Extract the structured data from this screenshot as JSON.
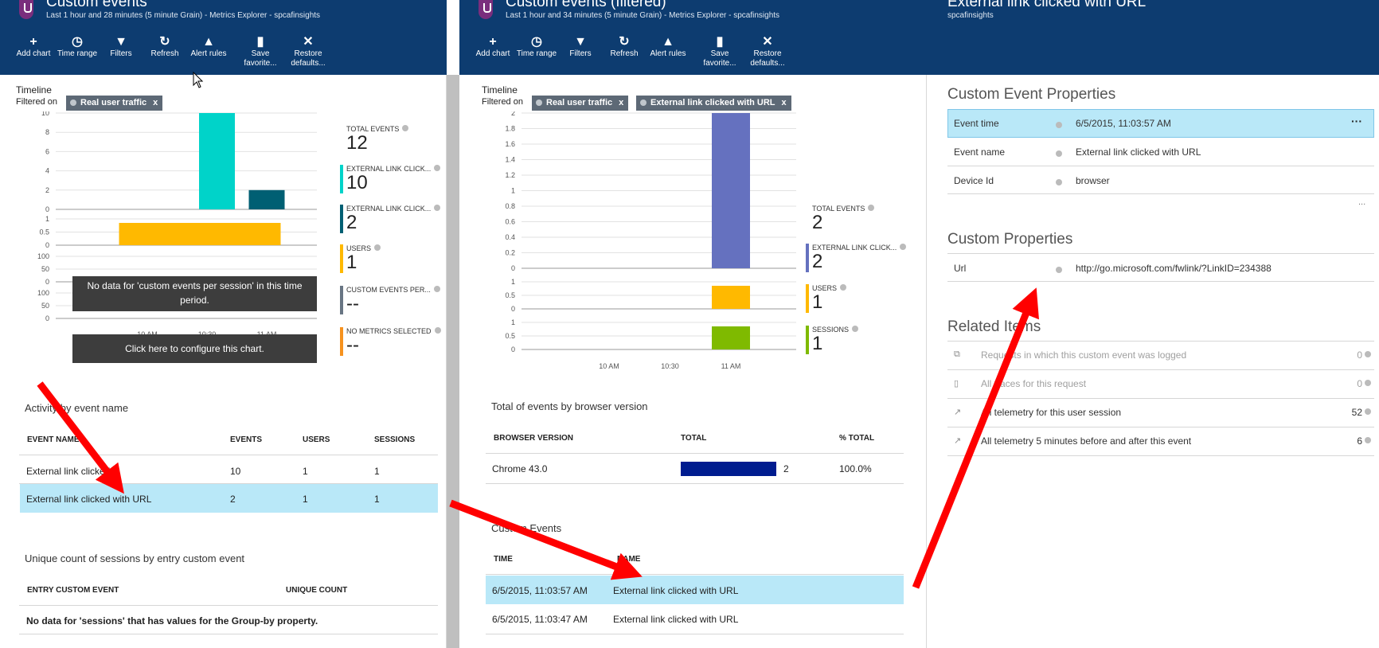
{
  "colors": {
    "header_bg": "#0d3c70",
    "highlight": "#b9e8f8",
    "teal": "#00d3c9",
    "navy_teal": "#005f73",
    "gold": "#ffb900",
    "slate": "#687583",
    "orange": "#f6921e",
    "purple": "#6571bf",
    "green": "#7fba00",
    "chrome_bar": "#001c8f",
    "arrow": "#ff0000"
  },
  "blade1": {
    "title": "Custom events",
    "subtitle": "Last 1 hour and 28 minutes (5 minute Grain) - Metrics Explorer - spcafinsights",
    "toolbar": [
      {
        "label": "Add chart",
        "icon": "plus-icon"
      },
      {
        "label": "Time range",
        "icon": "clock-icon"
      },
      {
        "label": "Filters",
        "icon": "funnel-icon"
      },
      {
        "label": "Refresh",
        "icon": "refresh-icon"
      },
      {
        "label": "Alert rules",
        "icon": "bell-icon"
      },
      {
        "label": "Save favorite...",
        "icon": "bookmark-icon"
      },
      {
        "label": "Restore defaults...",
        "icon": "close-icon"
      }
    ],
    "timeline_label": "Timeline",
    "filtered_on": "Filtered on",
    "filters": [
      "Real user traffic"
    ],
    "metrics": [
      {
        "label": "TOTAL EVENTS",
        "value": "12"
      },
      {
        "label": "EXTERNAL LINK CLICK...",
        "value": "10"
      },
      {
        "label": "EXTERNAL LINK CLICK...",
        "value": "2"
      },
      {
        "label": "USERS",
        "value": "1"
      },
      {
        "label": "CUSTOM EVENTS PER...",
        "value": "--"
      },
      {
        "label": "NO METRICS SELECTED",
        "value": "--"
      }
    ],
    "no_data_msg": "No data for 'custom events per session' in this time period.",
    "configure_msg": "Click here to configure this chart.",
    "activity_title": "Activity by event name",
    "activity_headers": [
      "EVENT NAME",
      "EVENTS",
      "USERS",
      "SESSIONS"
    ],
    "activity_rows": [
      [
        "External link clicked",
        "10",
        "1",
        "1"
      ],
      [
        "External link clicked with URL",
        "2",
        "1",
        "1"
      ]
    ],
    "unique_title": "Unique count of sessions by entry custom event",
    "unique_headers": [
      "ENTRY CUSTOM EVENT",
      "UNIQUE COUNT"
    ],
    "unique_empty": "No data for 'sessions' that has values for the Group-by property."
  },
  "blade2": {
    "title": "Custom events (filtered)",
    "subtitle": "Last 1 hour and 34 minutes (5 minute Grain) - Metrics Explorer - spcafinsights",
    "toolbar": [
      {
        "label": "Add chart",
        "icon": "plus-icon"
      },
      {
        "label": "Time range",
        "icon": "clock-icon"
      },
      {
        "label": "Filters",
        "icon": "funnel-icon"
      },
      {
        "label": "Refresh",
        "icon": "refresh-icon"
      },
      {
        "label": "Alert rules",
        "icon": "bell-icon"
      },
      {
        "label": "Save favorite...",
        "icon": "bookmark-icon"
      },
      {
        "label": "Restore defaults...",
        "icon": "close-icon"
      }
    ],
    "timeline_label": "Timeline",
    "filtered_on": "Filtered on",
    "filters": [
      "Real user traffic",
      "External link clicked with URL"
    ],
    "metrics": [
      {
        "label": "TOTAL EVENTS",
        "value": "2"
      },
      {
        "label": "EXTERNAL LINK CLICK...",
        "value": "2"
      },
      {
        "label": "USERS",
        "value": "1"
      },
      {
        "label": "SESSIONS",
        "value": "1"
      }
    ],
    "browser_title": "Total of events by browser version",
    "browser_headers": [
      "BROWSER VERSION",
      "TOTAL",
      "% TOTAL"
    ],
    "browser_rows": [
      {
        "version": "Chrome 43.0",
        "total": "2",
        "pct": "100.0%",
        "fraction": 1.0
      }
    ],
    "events_title": "Custom Events",
    "events_headers": [
      "TIME",
      "NAME"
    ],
    "events_rows": [
      [
        "6/5/2015, 11:03:57 AM",
        "External link clicked with URL"
      ],
      [
        "6/5/2015, 11:03:47 AM",
        "External link clicked with URL"
      ]
    ]
  },
  "blade3": {
    "title": "External link clicked with URL",
    "subtitle": "spcafinsights",
    "event_props_title": "Custom Event Properties",
    "event_props": [
      {
        "key": "Event time",
        "value": "6/5/2015, 11:03:57 AM"
      },
      {
        "key": "Event name",
        "value": "External link clicked with URL"
      },
      {
        "key": "Device Id",
        "value": "browser"
      }
    ],
    "more": "...",
    "custom_props_title": "Custom Properties",
    "custom_props": [
      {
        "key": "Url",
        "value": "http://go.microsoft.com/fwlink/?LinkID=234388"
      }
    ],
    "related_title": "Related Items",
    "related": [
      {
        "label": "Requests in which this custom event was logged",
        "count": "0",
        "icon": "request-icon"
      },
      {
        "label": "All traces for this request",
        "count": "0",
        "icon": "trace-icon"
      },
      {
        "label": "All telemetry for this user session",
        "count": "52",
        "icon": "arrow-link-icon"
      },
      {
        "label": "All telemetry 5 minutes before and after this event",
        "count": "6",
        "icon": "arrow-link-icon"
      }
    ]
  },
  "chart_data": [
    {
      "type": "bar",
      "title": "",
      "series": [
        {
          "name": "External link clicked",
          "x": [
            "10:35"
          ],
          "values": [
            10
          ]
        },
        {
          "name": "External link clicked with URL",
          "x": [
            "11:00"
          ],
          "values": [
            2
          ]
        }
      ],
      "x_ticks": [
        "10 AM",
        "10:30",
        "11 AM"
      ],
      "ylim": [
        0,
        10
      ],
      "y_ticks": [
        0,
        2,
        4,
        6,
        8,
        10
      ]
    },
    {
      "type": "bar",
      "title": "",
      "series": [
        {
          "name": "USERS",
          "x_range": [
            "9:45",
            "11:15"
          ],
          "values": [
            1
          ]
        }
      ],
      "ylim": [
        0,
        1
      ],
      "y_ticks": [
        0,
        0.5,
        1
      ]
    },
    {
      "type": "bar",
      "title": "",
      "series": [
        {
          "name": "External link clicked with URL",
          "x": [
            "11:00"
          ],
          "values": [
            2
          ]
        }
      ],
      "x_ticks": [
        "10 AM",
        "10:30",
        "11 AM"
      ],
      "ylim": [
        0,
        2
      ],
      "y_ticks": [
        0,
        0.2,
        0.4,
        0.6,
        0.8,
        1,
        1.2,
        1.4,
        1.6,
        1.8,
        2
      ]
    },
    {
      "type": "bar",
      "title": "",
      "series": [
        {
          "name": "USERS",
          "x": [
            "11:00"
          ],
          "values": [
            1
          ]
        }
      ],
      "ylim": [
        0,
        1
      ],
      "y_ticks": [
        0,
        0.5,
        1
      ]
    },
    {
      "type": "bar",
      "title": "",
      "series": [
        {
          "name": "SESSIONS",
          "x": [
            "11:00"
          ],
          "values": [
            1
          ]
        }
      ],
      "ylim": [
        0,
        1
      ],
      "y_ticks": [
        0,
        0.5,
        1
      ]
    }
  ]
}
